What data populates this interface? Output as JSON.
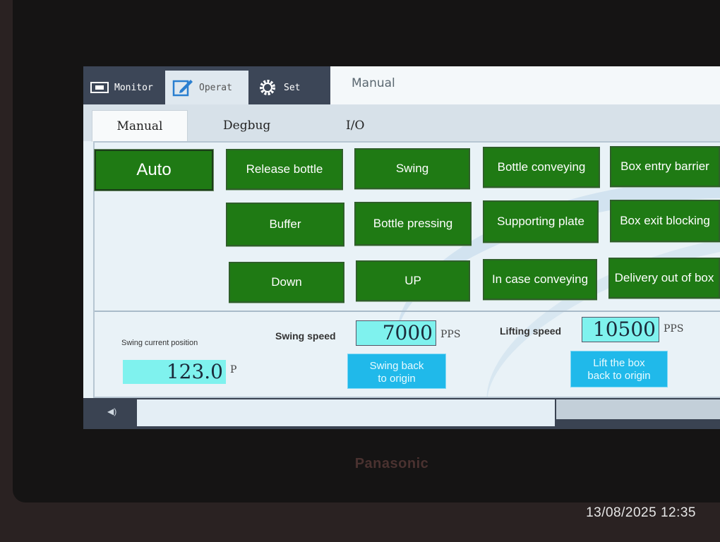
{
  "brand": "Panasonic",
  "timestamp": "13/08/2025 12:35",
  "top_tabs": [
    {
      "label": "Monitor",
      "icon": "monitor-icon"
    },
    {
      "label": "Operat",
      "icon": "edit-icon"
    },
    {
      "label": "Set",
      "icon": "gear-icon"
    }
  ],
  "title": "Manual",
  "sub_tabs": [
    "Manual",
    "Degbug",
    "I/O"
  ],
  "buttons": {
    "auto": "Auto",
    "release_bottle": "Release bottle",
    "swing": "Swing",
    "bottle_conveying": "Bottle conveying",
    "box_entry_barrier": "Box entry barrier",
    "buffer": "Buffer",
    "bottle_pressing": "Bottle pressing",
    "supporting_plate": "Supporting plate",
    "box_exit_blocking": "Box exit blocking",
    "down": "Down",
    "up": "UP",
    "in_case_conveying": "In case conveying",
    "delivery_out_of_box": "Delivery out of box"
  },
  "status": {
    "swing_position_label": "Swing current position",
    "swing_position_value": "123.0",
    "swing_position_unit": "P",
    "swing_speed_label": "Swing speed",
    "swing_speed_value": "7000",
    "swing_speed_unit": "PPS",
    "lifting_speed_label": "Lifting speed",
    "lifting_speed_value": "10500",
    "lifting_speed_unit": "PPS",
    "swing_back_line1": "Swing back",
    "swing_back_line2": "to origin",
    "lift_box_line1": "Lift the box",
    "lift_box_line2": "back to origin"
  },
  "colors": {
    "button_green": "#1f7a14",
    "value_cyan": "#7ff2ee",
    "action_blue": "#20b9ea",
    "bar_dark": "#3c4657"
  }
}
